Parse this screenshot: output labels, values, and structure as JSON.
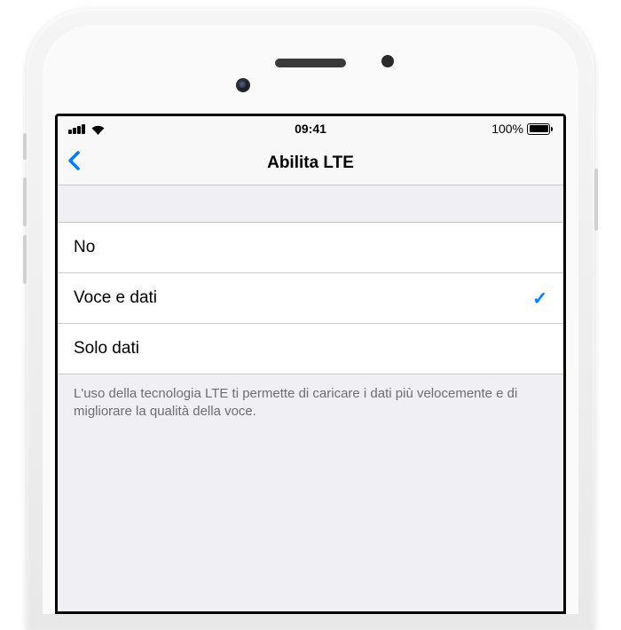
{
  "status_bar": {
    "time": "09:41",
    "battery_text": "100%"
  },
  "nav": {
    "title": "Abilita LTE"
  },
  "options": [
    {
      "label": "No",
      "selected": false
    },
    {
      "label": "Voce e dati",
      "selected": true
    },
    {
      "label": "Solo dati",
      "selected": false
    }
  ],
  "footer": "L'uso della tecnologia LTE ti permette di caricare i dati più velocemente e di migliorare la qualità della voce."
}
